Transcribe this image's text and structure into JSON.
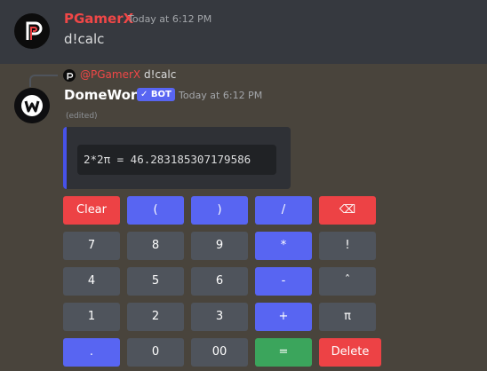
{
  "message1": {
    "username": "PGamerX",
    "username_color": "#f04747",
    "timestamp": "Today at 6:12 PM",
    "content": "d!calc"
  },
  "message2": {
    "reply": {
      "username": "@PGamerX",
      "content": "d!calc"
    },
    "username": "DomeWork",
    "bot_badge": "✓ BOT",
    "timestamp": "Today at 6:12 PM",
    "edited": "(edited)",
    "embed": {
      "code": "2*2π = 46.283185307179586",
      "accent_color": "#4752e8"
    }
  },
  "calculator": {
    "rows": [
      [
        {
          "label": "Clear",
          "style": "danger"
        },
        {
          "label": "(",
          "style": "primary"
        },
        {
          "label": ")",
          "style": "primary"
        },
        {
          "label": "/",
          "style": "primary"
        },
        {
          "label": "⌫",
          "style": "danger"
        }
      ],
      [
        {
          "label": "7",
          "style": "secondary"
        },
        {
          "label": "8",
          "style": "secondary"
        },
        {
          "label": "9",
          "style": "secondary"
        },
        {
          "label": "*",
          "style": "primary"
        },
        {
          "label": "!",
          "style": "secondary"
        }
      ],
      [
        {
          "label": "4",
          "style": "secondary"
        },
        {
          "label": "5",
          "style": "secondary"
        },
        {
          "label": "6",
          "style": "secondary"
        },
        {
          "label": "-",
          "style": "primary"
        },
        {
          "label": "ˆ",
          "style": "secondary"
        }
      ],
      [
        {
          "label": "1",
          "style": "secondary"
        },
        {
          "label": "2",
          "style": "secondary"
        },
        {
          "label": "3",
          "style": "secondary"
        },
        {
          "label": "+",
          "style": "primary"
        },
        {
          "label": "π",
          "style": "secondary"
        }
      ],
      [
        {
          "label": ".",
          "style": "primary"
        },
        {
          "label": "0",
          "style": "secondary"
        },
        {
          "label": "00",
          "style": "secondary"
        },
        {
          "label": "=",
          "style": "success"
        },
        {
          "label": "Delete",
          "style": "danger"
        }
      ]
    ]
  }
}
